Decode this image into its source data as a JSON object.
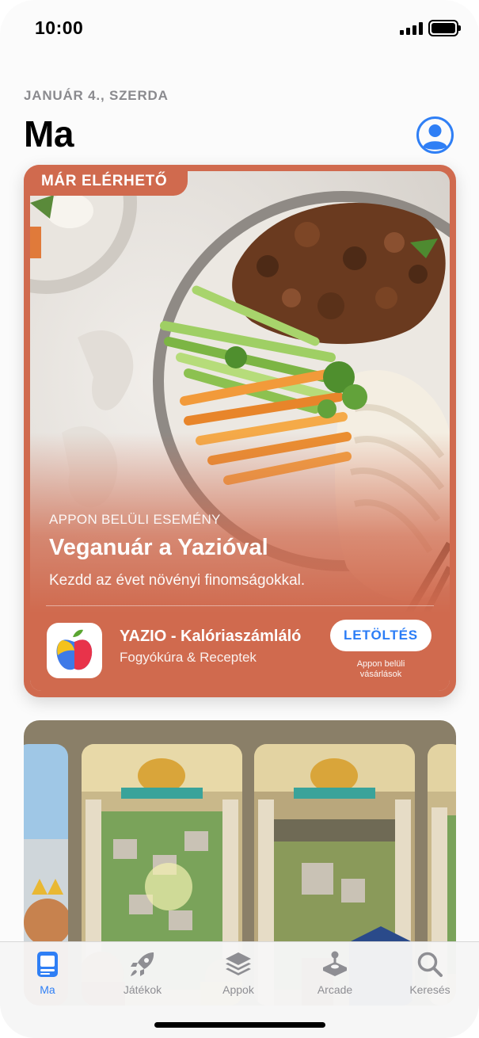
{
  "status_bar": {
    "time": "10:00"
  },
  "header": {
    "date": "JANUÁR 4., SZERDA",
    "title": "Ma"
  },
  "featured": {
    "badge": "MÁR ELÉRHETŐ",
    "eyebrow": "APPON BELÜLI ESEMÉNY",
    "headline": "Veganuár a Yazióval",
    "subtitle": "Kezdd az évet növényi finomságokkal.",
    "app_name": "YAZIO - Kalóriaszámláló",
    "app_category": "Fogyókúra & Receptek",
    "get_label": "LETÖLTÉS",
    "iap_line1": "Appon belüli",
    "iap_line2": "vásárlások",
    "accent_color": "#d06a4e"
  },
  "tabs": [
    {
      "label": "Ma",
      "icon": "today-icon",
      "active": true
    },
    {
      "label": "Játékok",
      "icon": "rocket-icon",
      "active": false
    },
    {
      "label": "Appok",
      "icon": "layers-icon",
      "active": false
    },
    {
      "label": "Arcade",
      "icon": "joystick-icon",
      "active": false
    },
    {
      "label": "Keresés",
      "icon": "search-icon",
      "active": false
    }
  ],
  "colors": {
    "accent": "#2f7ff5",
    "tab_inactive": "#8e8e93"
  }
}
